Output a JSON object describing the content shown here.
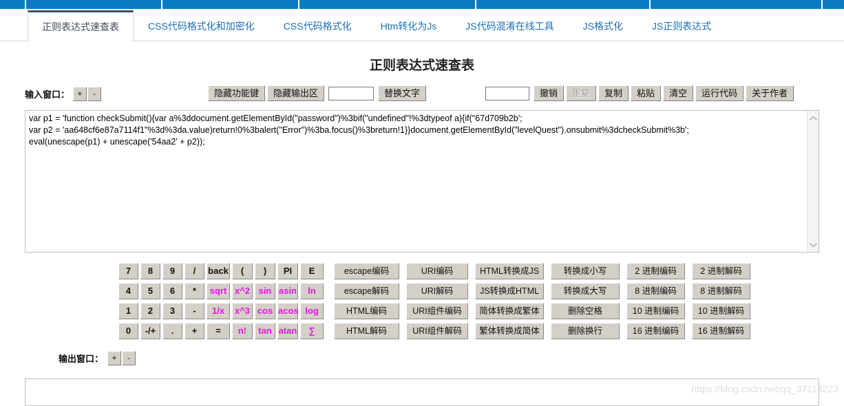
{
  "topbar": {
    "color": "#0b7bc1",
    "segment_widths": [
      38,
      198,
      199,
      257,
      253,
      250,
      31
    ]
  },
  "tabs": [
    {
      "label": "正则表达式速查表",
      "active": true
    },
    {
      "label": "CSS代码格式化和加密化",
      "active": false
    },
    {
      "label": "CSS代码格式化",
      "active": false
    },
    {
      "label": "Htm转化为Js",
      "active": false
    },
    {
      "label": "JS代码混淆在线工具",
      "active": false
    },
    {
      "label": "JS格式化",
      "active": false
    },
    {
      "label": "JS正则表达式",
      "active": false
    }
  ],
  "page": {
    "title": "正则表达式速查表",
    "watermark": "https://blog.csdn.net/qq_37113223",
    "tab_link_color": "#1a6fb5",
    "accent_color": "#39506b",
    "magenta": "#e713e7"
  },
  "toolbar": {
    "input_window_label": "输入窗口：",
    "plus_label": "+",
    "minus_label": "-",
    "hide_function_keys": "隐藏功能键",
    "hide_output_area": "隐藏输出区",
    "replace_input_value": "",
    "replace_button": "替换文字",
    "find_input_value": "",
    "undo": "撤销",
    "redo": "重复",
    "redo_disabled": true,
    "copy": "复制",
    "paste": "粘贴",
    "clear": "清空",
    "run_code": "运行代码",
    "about_author": "关于作者"
  },
  "editor": {
    "content": "var p1 = 'function checkSubmit(){var a%3ddocument.getElementById(\"password\")%3bif(\"undefined\"!%3dtypeof a){if(\"67d709b2b';\nvar p2 = 'aa648cf6e87a7114f1\"%3d%3da.value)return!0%3balert(\"Error\")%3ba.focus()%3breturn!1}}document.getElementById(\"levelQuest\").onsubmit%3dcheckSubmit%3b';\neval(unescape(p1) + unescape('54aa2' + p2));",
    "scroll_up_icon": "chevron-up-icon",
    "scroll_down_icon": "chevron-down-icon"
  },
  "keypad": {
    "rows": [
      {
        "nums": [
          "7",
          "8",
          "9",
          "/"
        ],
        "special": "back",
        "sci": [
          "(",
          ")",
          "PI",
          "E"
        ],
        "sci_magenta": false,
        "special_magenta": false,
        "converts": [
          "escape编码",
          "URI编码",
          "HTML转换成JS",
          "转换成小写",
          "2 进制编码",
          "2 进制解码"
        ]
      },
      {
        "nums": [
          "4",
          "5",
          "6",
          "*"
        ],
        "special": "sqrt",
        "sci": [
          "x^2",
          "sin",
          "asin",
          "ln"
        ],
        "sci_magenta": true,
        "special_magenta": true,
        "converts": [
          "escape解码",
          "URI解码",
          "JS转换成HTML",
          "转换成大写",
          "8 进制编码",
          "8 进制解码"
        ]
      },
      {
        "nums": [
          "1",
          "2",
          "3",
          "-"
        ],
        "special": "1/x",
        "sci": [
          "x^3",
          "cos",
          "acos",
          "log"
        ],
        "sci_magenta": true,
        "special_magenta": true,
        "converts": [
          "HTML编码",
          "URI组件编码",
          "简体转换成繁体",
          "删除空格",
          "10 进制编码",
          "10 进制解码"
        ]
      },
      {
        "nums": [
          "0",
          "-/+",
          ".",
          "+"
        ],
        "special": "=",
        "sci": [
          "n!",
          "tan",
          "atan",
          "∑"
        ],
        "sci_magenta": true,
        "special_magenta": false,
        "converts": [
          "HTML解码",
          "URI组件解码",
          "繁体转换成简体",
          "删除换行",
          "16 进制编码",
          "16 进制解码"
        ]
      }
    ]
  },
  "output": {
    "label": "输出窗口：",
    "plus_label": "+",
    "minus_label": "-",
    "content": ""
  }
}
